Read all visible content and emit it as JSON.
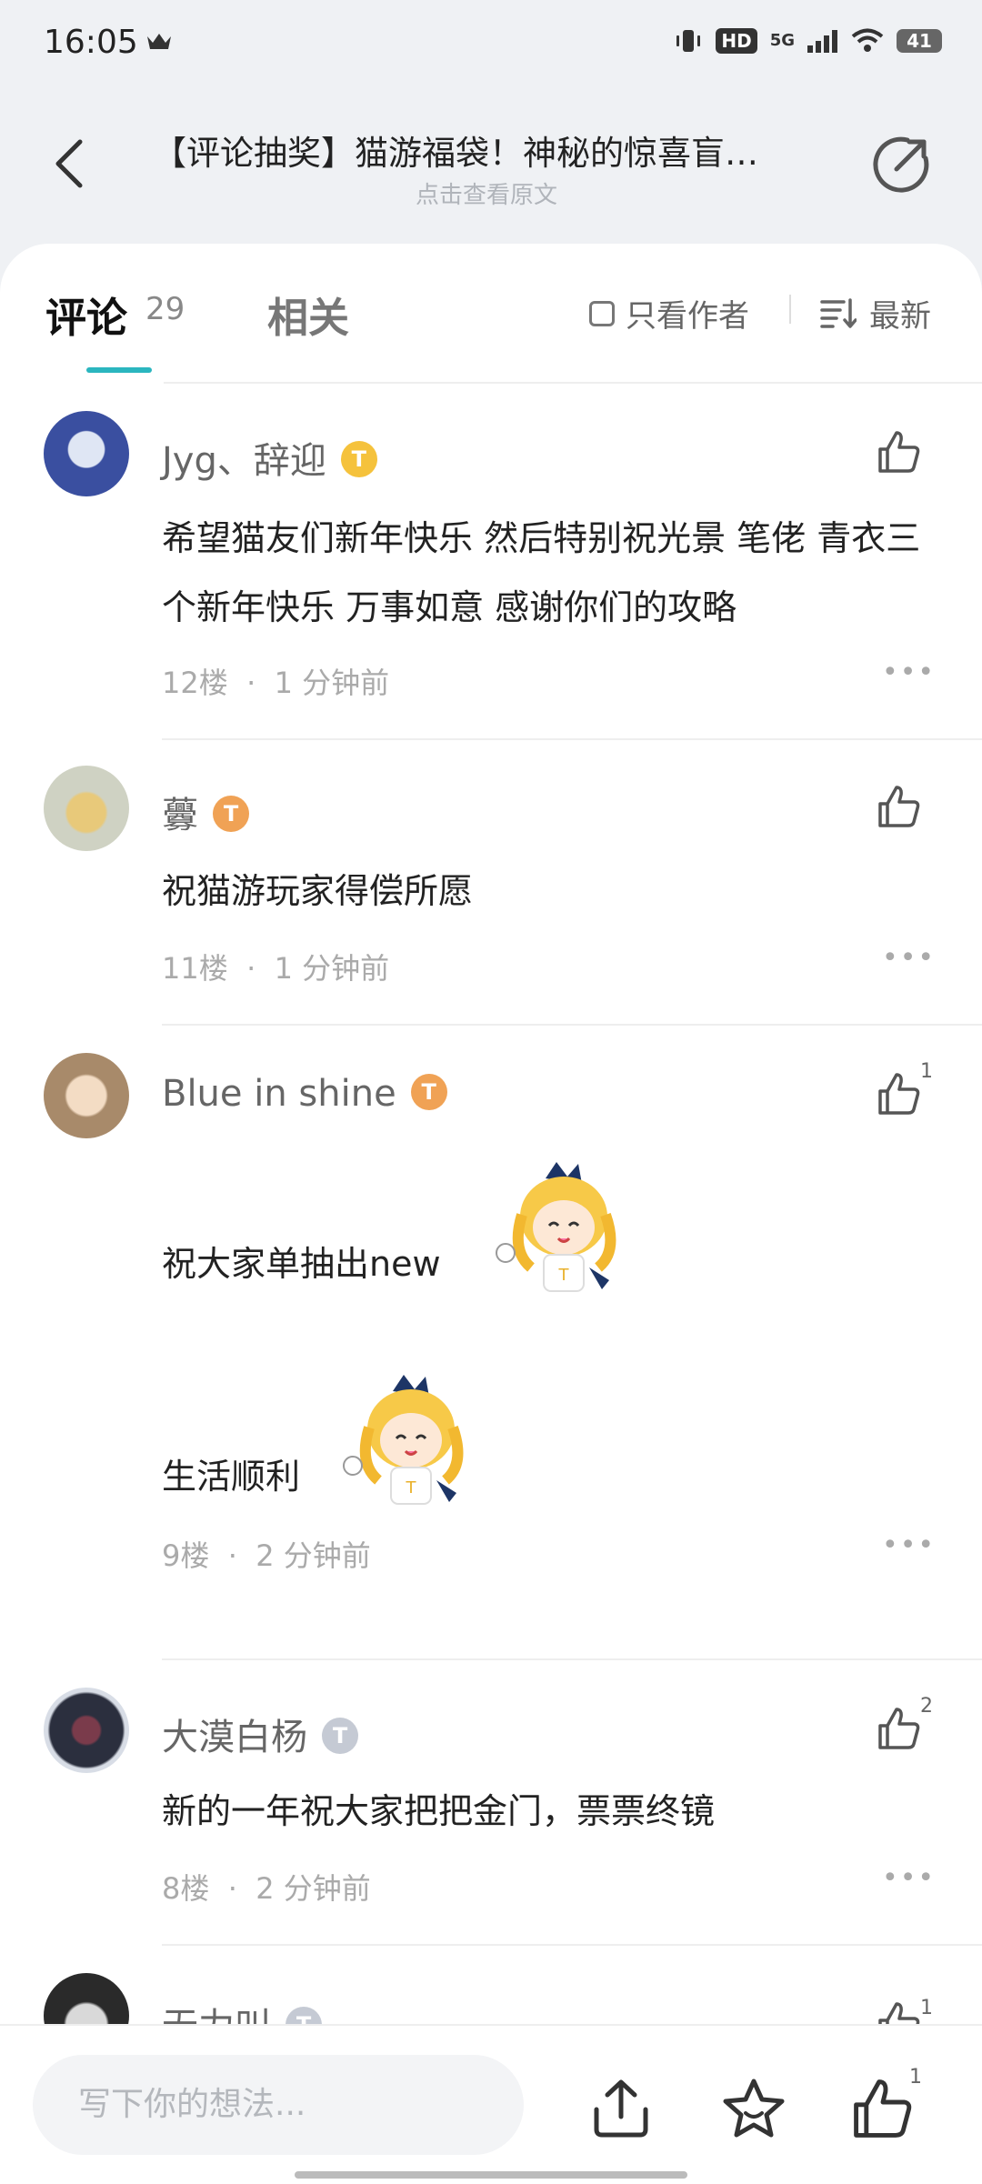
{
  "status_bar": {
    "time": "16:05",
    "network": "5G",
    "hd": "HD",
    "battery": "41"
  },
  "header": {
    "title": "【评论抽奖】猫游福袋！神秘的惊喜盲…",
    "subtitle": "点击查看原文"
  },
  "tabs": {
    "comments_label": "评论",
    "comments_count": "29",
    "related_label": "相关",
    "author_only_label": "只看作者",
    "sort_label": "最新"
  },
  "comments": [
    {
      "name": "Jyg、辞迎",
      "level": "1",
      "badge_color": "#f5c23c",
      "text": "希望猫友们新年快乐 然后特别祝光景 笔佬 青衣三个新年快乐 万事如意 感谢你们的攻略",
      "floor": "12楼",
      "time": "1 分钟前",
      "likes": ""
    },
    {
      "name": "虋",
      "level": "6",
      "badge_color": "#f0a255",
      "text": "祝猫游玩家得偿所愿",
      "floor": "11楼",
      "time": "1 分钟前",
      "likes": ""
    },
    {
      "name": "Blue in shine",
      "level": "10",
      "badge_color": "#f0a255",
      "text_line1": "祝大家单抽出new",
      "text_line2": "生活顺利",
      "floor": "9楼",
      "time": "2 分钟前",
      "likes": "1"
    },
    {
      "name": "大漠白杨",
      "level": "2",
      "badge_color": "#c5cad4",
      "text": "新的一年祝大家把把金门，票票终镜",
      "floor": "8楼",
      "time": "2 分钟前",
      "likes": "2"
    },
    {
      "name": "无力叫",
      "likes": "1"
    }
  ],
  "bottom_bar": {
    "input_placeholder": "写下你的想法...",
    "like_count": "1"
  },
  "colors": {
    "accent": "#2bb6bf",
    "background": "#eff1f4"
  }
}
